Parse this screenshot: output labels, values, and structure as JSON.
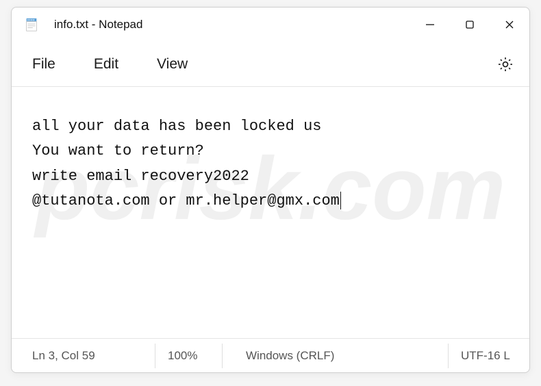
{
  "titlebar": {
    "title": "info.txt - Notepad"
  },
  "menubar": {
    "file": "File",
    "edit": "Edit",
    "view": "View"
  },
  "content": {
    "text": "all your data has been locked us\nYou want to return?\nwrite email recovery2022\n@tutanota.com or mr.helper@gmx.com"
  },
  "statusbar": {
    "position": "Ln 3, Col 59",
    "zoom": "100%",
    "line_ending": "Windows (CRLF)",
    "encoding": "UTF-16 L"
  },
  "watermark": {
    "text": "pcrisk.com"
  }
}
